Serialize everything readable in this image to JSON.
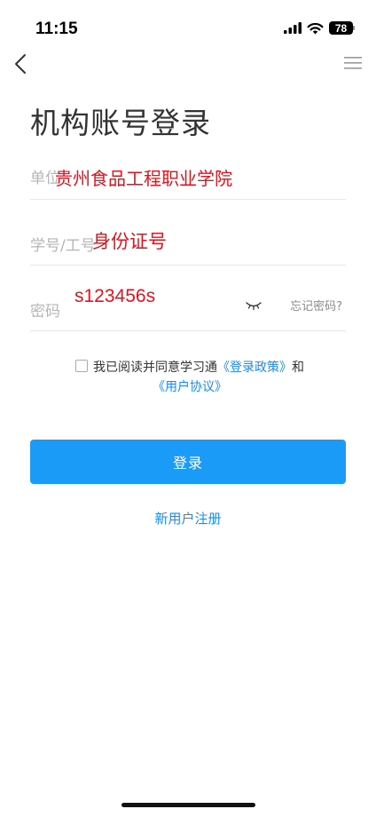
{
  "status_bar": {
    "time": "11:15",
    "battery": "78"
  },
  "page": {
    "title": "机构账号登录"
  },
  "form": {
    "school": {
      "placeholder": "单位",
      "value": "贵州食品工程职业学院"
    },
    "student_id": {
      "placeholder": "学号/工号",
      "value": "身份证号"
    },
    "password": {
      "placeholder": "密码",
      "value": "s123456s",
      "forgot": "忘记密码?"
    }
  },
  "agreement": {
    "prefix": "我已阅读并同意学习通",
    "policy": "《登录政策》",
    "and": "和",
    "user_agreement": "《用户协议》"
  },
  "login_button": "登录",
  "register": "新用户注册",
  "colors": {
    "accent": "#1a9bf7",
    "overlay_red": "#e8111a"
  }
}
